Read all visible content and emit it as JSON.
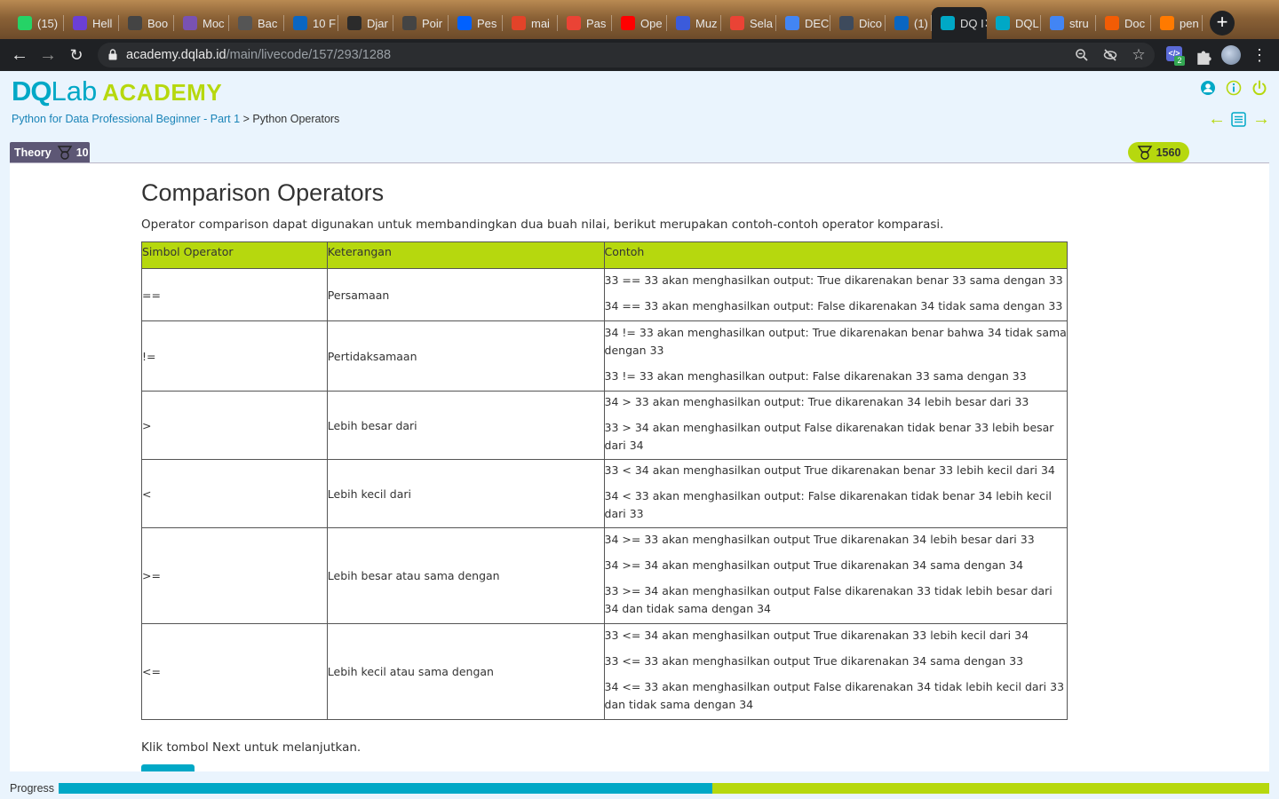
{
  "browser": {
    "tabs": [
      {
        "label": "(15)",
        "icon": "whatsapp-icon",
        "color": "#25d366"
      },
      {
        "label": "Hell",
        "icon": "hexagon-icon",
        "color": "#6b3fd6"
      },
      {
        "label": "Boo",
        "icon": "globe-icon",
        "color": "#444"
      },
      {
        "label": "Moc",
        "icon": "bootstrap-icon",
        "color": "#7952b3"
      },
      {
        "label": "Bac",
        "icon": "bird-icon",
        "color": "#555"
      },
      {
        "label": "10 F",
        "icon": "a-icon",
        "color": "#0a66c2"
      },
      {
        "label": "Djar",
        "icon": "django-icon",
        "color": "#2b2b2b"
      },
      {
        "label": "Poir",
        "icon": "globe-icon",
        "color": "#444"
      },
      {
        "label": "Pes",
        "icon": "dropbox-icon",
        "color": "#0061ff"
      },
      {
        "label": "mai",
        "icon": "gitlab-icon",
        "color": "#e24329"
      },
      {
        "label": "Pas",
        "icon": "gmail-icon",
        "color": "#ea4335"
      },
      {
        "label": "Ope",
        "icon": "youtube-icon",
        "color": "#ff0000"
      },
      {
        "label": "Muz",
        "icon": "shield-icon",
        "color": "#3b5bdb"
      },
      {
        "label": "Sela",
        "icon": "gmail-icon",
        "color": "#ea4335"
      },
      {
        "label": "DEC",
        "icon": "docs-icon",
        "color": "#4285f4"
      },
      {
        "label": "Dico",
        "icon": "g-icon",
        "color": "#3d4a5c"
      },
      {
        "label": "(1) I",
        "icon": "linkedin-icon",
        "color": "#0a66c2"
      },
      {
        "label": "DQ I",
        "icon": "dqlab-icon",
        "color": "#00a8c6",
        "active": true
      },
      {
        "label": "DQL",
        "icon": "dqlab-icon",
        "color": "#00a8c6"
      },
      {
        "label": "stru",
        "icon": "google-icon",
        "color": "#4285f4"
      },
      {
        "label": "Doc",
        "icon": "arc-icon",
        "color": "#f25c05"
      },
      {
        "label": "pen",
        "icon": "book-icon",
        "color": "#ff7a00"
      }
    ],
    "url_host": "academy.dqlab.id",
    "url_path": "/main/livecode/157/293/1288",
    "extension_badge": "2"
  },
  "header": {
    "logo_dq": "DQ",
    "logo_lab": "Lab",
    "logo_academy": "ACADEMY",
    "breadcrumb_course": "Python for Data Professional Beginner - Part 1",
    "breadcrumb_sep": " > ",
    "breadcrumb_current": "Python Operators"
  },
  "status": {
    "theory_label": "Theory",
    "theory_points": "10",
    "total_points": "1560"
  },
  "lesson": {
    "title": "Comparison Operators",
    "intro": "Operator comparison dapat digunakan untuk membandingkan dua buah nilai, berikut merupakan contoh-contoh operator komparasi.",
    "table_headers": [
      "Simbol Operator",
      "Keterangan",
      "Contoh"
    ],
    "rows": [
      {
        "symbol": "==",
        "desc": "Persamaan",
        "examples": [
          "33 == 33 akan menghasilkan output: True dikarenakan benar 33 sama dengan 33",
          "34 == 33 akan menghasilkan output: False dikarenakan 34 tidak sama dengan 33"
        ]
      },
      {
        "symbol": "!=",
        "desc": "Pertidaksamaan",
        "examples": [
          "34 != 33 akan menghasilkan output: True dikarenakan benar bahwa 34 tidak sama dengan 33",
          "33 != 33 akan menghasilkan output: False dikarenakan 33 sama dengan 33"
        ]
      },
      {
        "symbol": ">",
        "desc": "Lebih besar dari",
        "examples": [
          "34 > 33 akan menghasilkan output: True dikarenakan 34 lebih besar dari 33",
          "33 > 34 akan menghasilkan output False dikarenakan tidak benar 33 lebih besar dari 34"
        ]
      },
      {
        "symbol": "<",
        "desc": "Lebih kecil dari",
        "examples": [
          "33 < 34 akan menghasilkan output True dikarenakan benar 33 lebih kecil dari 34",
          "34 < 33 akan menghasilkan output: False dikarenakan tidak benar 34 lebih kecil dari 33"
        ]
      },
      {
        "symbol": ">=",
        "desc": "Lebih besar atau sama dengan",
        "examples": [
          "34 >= 33 akan menghasilkan output True dikarenakan 34 lebih besar dari 33",
          "34 >= 34 akan menghasilkan output True dikarenakan 34 sama dengan 34",
          "33 >= 34 akan menghasilkan output False dikarenakan 33 tidak lebih besar dari 34 dan tidak sama dengan 34"
        ]
      },
      {
        "symbol": "<=",
        "desc": "Lebih kecil atau sama dengan",
        "examples": [
          "33 <= 34 akan menghasilkan output True dikarenakan 33 lebih kecil dari 34",
          "33 <= 33 akan menghasilkan output True dikarenakan 34 sama dengan 33",
          "34 <= 33 akan menghasilkan output False dikarenakan 34 tidak lebih kecil dari 33 dan tidak sama dengan 34"
        ]
      }
    ],
    "next_instruction": "Klik tombol Next untuk melanjutkan."
  },
  "progress": {
    "label": "Progress",
    "fraction": 0.54
  },
  "colors": {
    "accent_blue": "#00a8c6",
    "accent_green": "#b6d80e",
    "theory_purple": "#5d5775"
  }
}
